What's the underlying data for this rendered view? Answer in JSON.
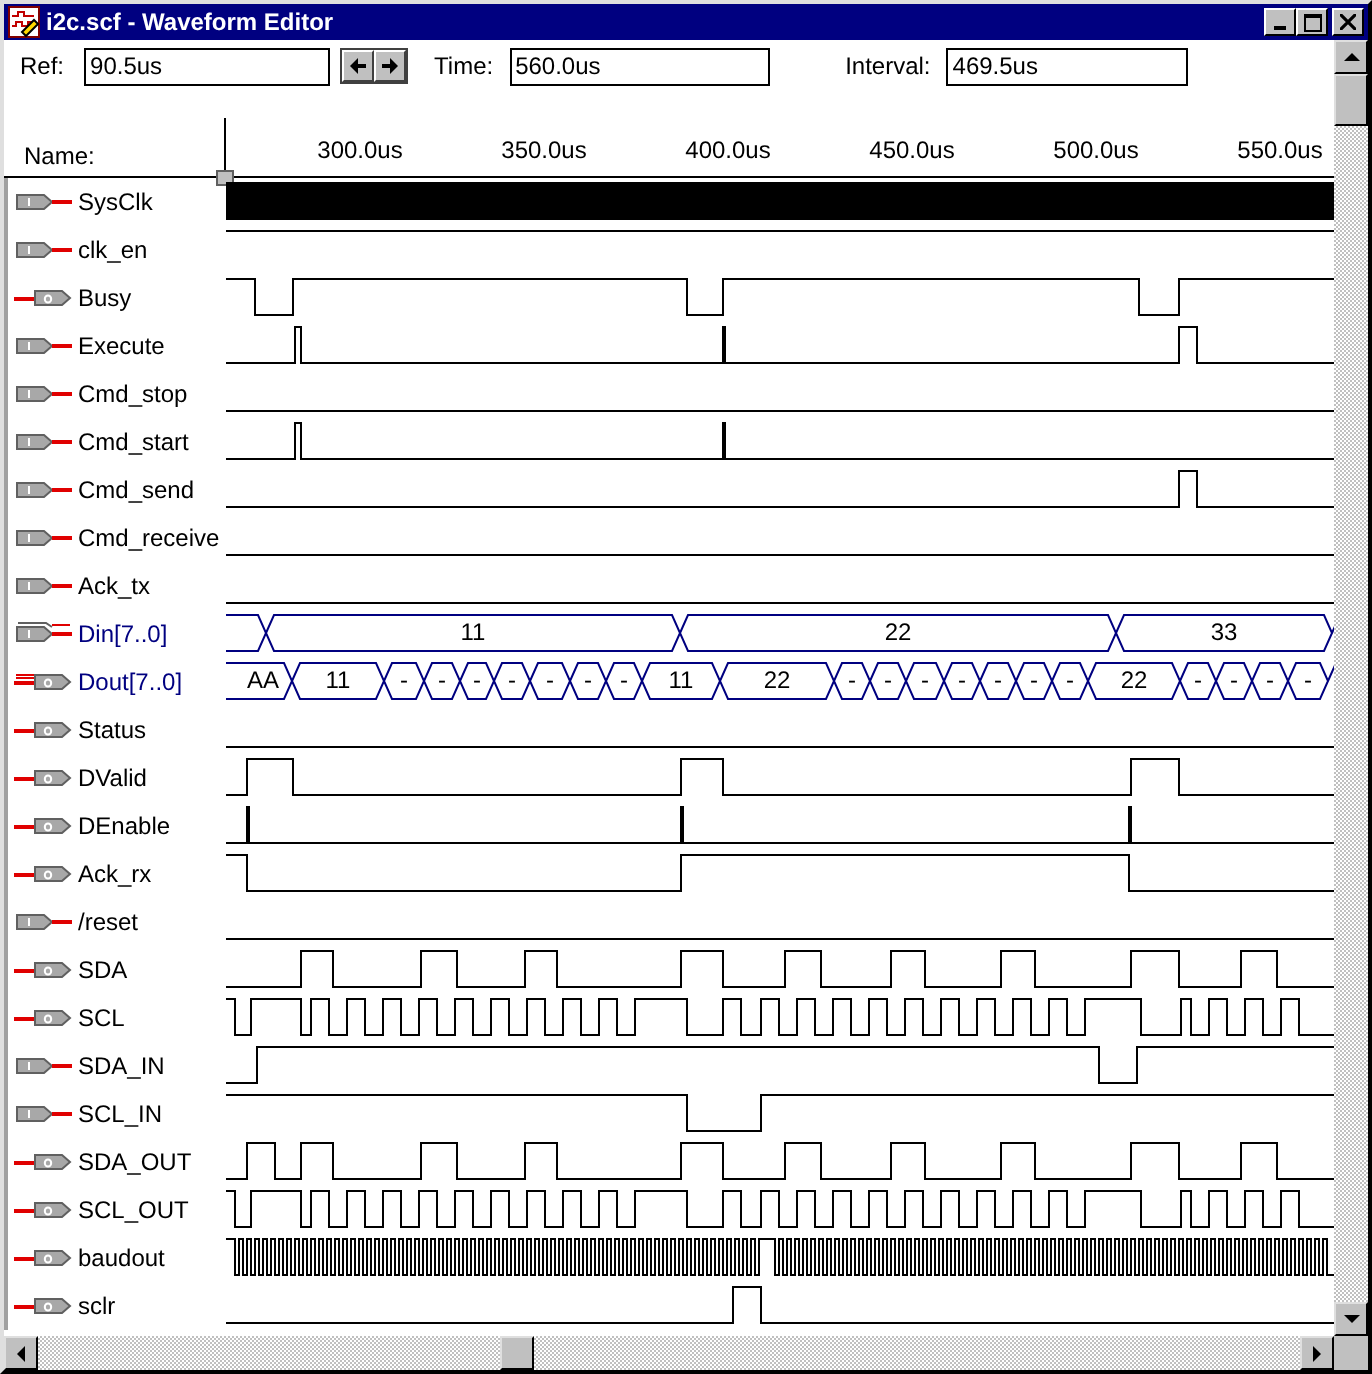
{
  "window": {
    "title": "i2c.scf - Waveform Editor"
  },
  "toolbar": {
    "ref_label": "Ref:",
    "ref_value": "90.5us",
    "time_label": "Time:",
    "time_value": "560.0us",
    "interval_label": "Interval:",
    "interval_value": "469.5us"
  },
  "name_header": "Name:",
  "ruler": {
    "labels": [
      "300.0us",
      "350.0us",
      "400.0us",
      "450.0us",
      "500.0us",
      "550.0us"
    ]
  },
  "signals": [
    {
      "name": "SysClk",
      "kind": "input"
    },
    {
      "name": "clk_en",
      "kind": "input"
    },
    {
      "name": "Busy",
      "kind": "output"
    },
    {
      "name": "Execute",
      "kind": "input"
    },
    {
      "name": "Cmd_stop",
      "kind": "input"
    },
    {
      "name": "Cmd_start",
      "kind": "input"
    },
    {
      "name": "Cmd_send",
      "kind": "input"
    },
    {
      "name": "Cmd_receive",
      "kind": "input"
    },
    {
      "name": "Ack_tx",
      "kind": "input"
    },
    {
      "name": "Din[7..0]",
      "kind": "input_bus",
      "segments": [
        "11",
        "22",
        "33"
      ]
    },
    {
      "name": "Dout[7..0]",
      "kind": "output_bus",
      "segments": [
        "AA",
        "11",
        "-",
        "-",
        "-",
        "-",
        "-",
        "-",
        "-",
        "11",
        "22",
        "-",
        "-",
        "-",
        "-",
        "-",
        "-",
        "-",
        "22",
        "-",
        "-",
        "-",
        "-"
      ]
    },
    {
      "name": "Status",
      "kind": "output"
    },
    {
      "name": "DValid",
      "kind": "output"
    },
    {
      "name": "DEnable",
      "kind": "output"
    },
    {
      "name": "Ack_rx",
      "kind": "output"
    },
    {
      "name": "/reset",
      "kind": "input"
    },
    {
      "name": "SDA",
      "kind": "output"
    },
    {
      "name": "SCL",
      "kind": "output"
    },
    {
      "name": "SDA_IN",
      "kind": "input"
    },
    {
      "name": "SCL_IN",
      "kind": "input"
    },
    {
      "name": "SDA_OUT",
      "kind": "output"
    },
    {
      "name": "SCL_OUT",
      "kind": "output"
    },
    {
      "name": "baudout",
      "kind": "output"
    },
    {
      "name": "sclr",
      "kind": "output"
    }
  ]
}
